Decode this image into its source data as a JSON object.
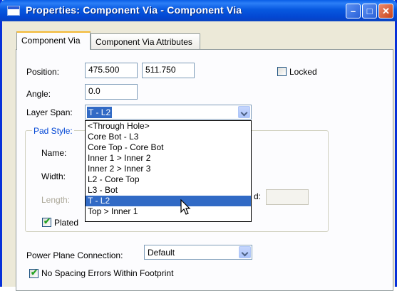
{
  "window": {
    "title": "Properties: Component Via - Component Via",
    "minimize_glyph": "–",
    "maximize_glyph": "□",
    "close_glyph": "✕"
  },
  "tabs": [
    {
      "label": "Component Via",
      "active": true
    },
    {
      "label": "Component Via Attributes",
      "active": false
    }
  ],
  "position": {
    "label": "Position:",
    "x": "475.500",
    "y": "511.750"
  },
  "locked": {
    "label": "Locked",
    "checked": false
  },
  "angle": {
    "label": "Angle:",
    "value": "0.0"
  },
  "layer_span": {
    "label": "Layer Span:",
    "value": "T - L2"
  },
  "pad_style": {
    "title": "Pad Style:",
    "name_label": "Name:",
    "width_label": "Width:",
    "length_label": "Length:",
    "trailing_label_fragment": "d:",
    "plated_label": "Plated",
    "plated_checked": true
  },
  "layer_span_options": [
    "<Through Hole>",
    "Core Bot - L3",
    "Core Top - Core Bot",
    "Inner 1 > Inner 2",
    "Inner 2 > Inner 3",
    "L2 - Core Top",
    "L3 - Bot",
    "T - L2",
    "Top > Inner 1"
  ],
  "layer_span_selected_index": 7,
  "power_plane": {
    "label": "Power Plane Connection:",
    "value": "Default"
  },
  "no_spacing": {
    "label": "No Spacing Errors Within Footprint",
    "checked": true
  },
  "colors": {
    "title_bar": "#0a5ee6",
    "selection": "#316ac5",
    "group_title": "#0046d5",
    "dialog_bg": "#ece9d8"
  }
}
